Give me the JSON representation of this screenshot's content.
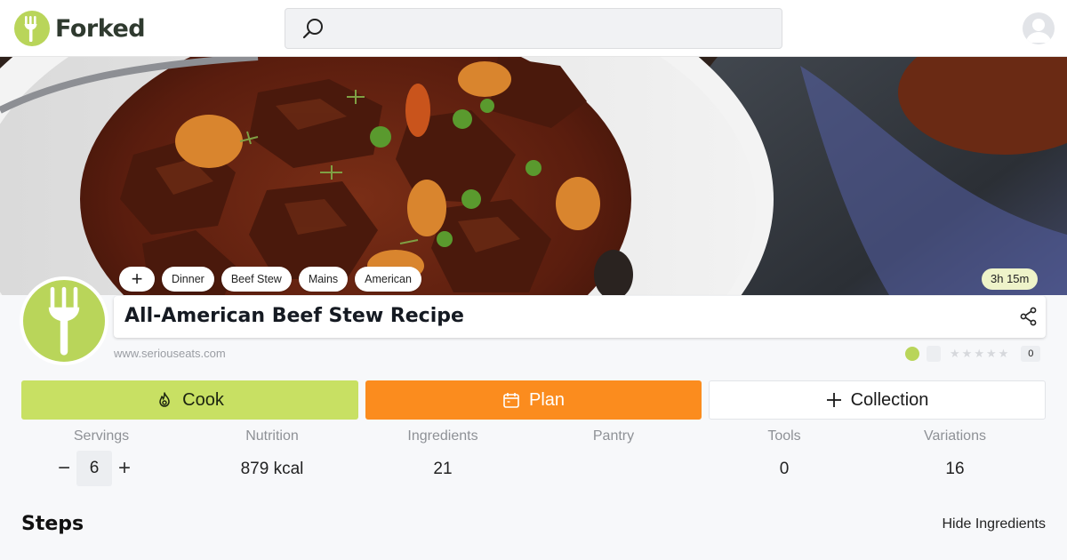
{
  "app": {
    "name": "Forked"
  },
  "search": {
    "placeholder": ""
  },
  "recipe": {
    "title": "All-American Beef Stew Recipe",
    "source": "www.seriouseats.com",
    "duration": "3h 15m",
    "tags": [
      "Dinner",
      "Beef Stew",
      "Mains",
      "American"
    ],
    "rating": {
      "stars": 0,
      "max": 5,
      "count": "0"
    }
  },
  "actions": {
    "cook": "Cook",
    "plan": "Plan",
    "collection": "Collection"
  },
  "stats": {
    "servings": {
      "label": "Servings",
      "value": "6"
    },
    "nutrition": {
      "label": "Nutrition",
      "value": "879 kcal"
    },
    "ingredients": {
      "label": "Ingredients",
      "value": "21"
    },
    "pantry": {
      "label": "Pantry",
      "value": ""
    },
    "tools": {
      "label": "Tools",
      "value": "0"
    },
    "variations": {
      "label": "Variations",
      "value": "16"
    }
  },
  "steps": {
    "heading": "Steps",
    "hide_ingredients": "Hide Ingredients"
  },
  "colors": {
    "brand": "#b9d55a",
    "cook": "#c8e063",
    "plan": "#fb8c1e",
    "duration_badge": "#eef3c9"
  },
  "icons": [
    "fork-icon",
    "search-icon",
    "user-icon",
    "plus-icon",
    "share-icon",
    "flame-icon",
    "calendar-icon",
    "star-icon",
    "minus-icon"
  ]
}
